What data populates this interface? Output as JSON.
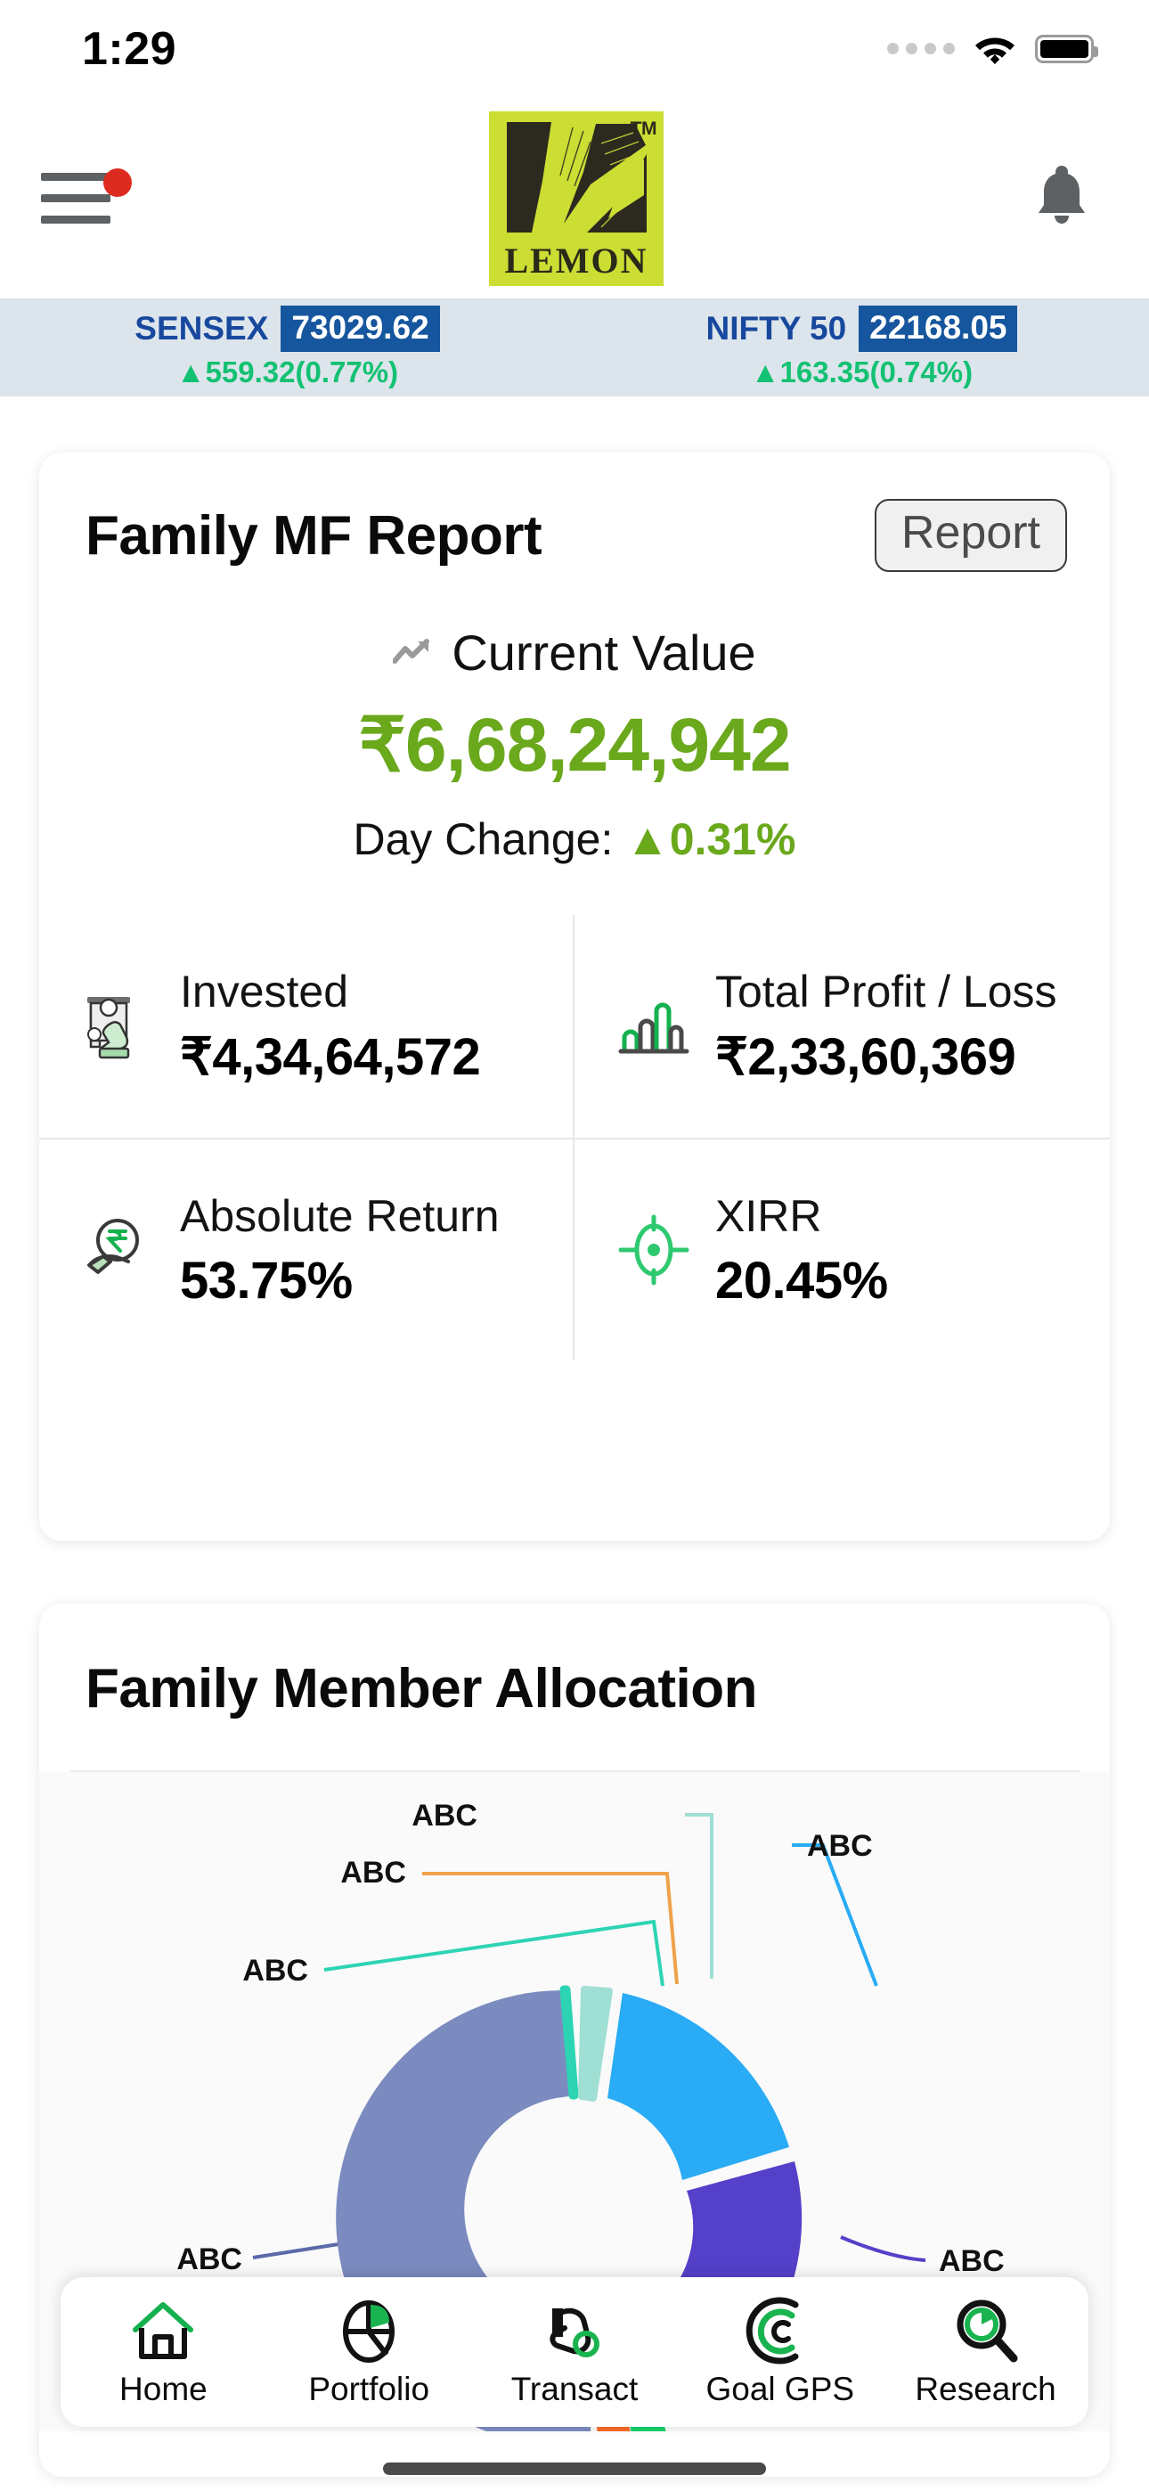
{
  "statusbar": {
    "time": "1:29",
    "signal_icon": "signal-dots-icon",
    "wifi_icon": "wifi-icon",
    "battery_icon": "battery-icon"
  },
  "header": {
    "menu_icon": "hamburger-menu-icon",
    "notification_dot": "notification-dot",
    "logo_word": "LEMON",
    "logo_tm": "TM",
    "bell_icon": "bell-icon"
  },
  "ticker": [
    {
      "name": "SENSEX",
      "value": "73029.62",
      "change": "▲559.32(0.77%)"
    },
    {
      "name": "NIFTY 50",
      "value": "22168.05",
      "change": "▲163.35(0.74%)"
    }
  ],
  "mf_report": {
    "title": "Family MF Report",
    "report_button": "Report",
    "current_value_label": "Current Value",
    "trend_icon": "trend-up-icon",
    "current_value": "₹6,68,24,942",
    "day_change_label": "Day Change:",
    "day_change_value": "▲0.31%",
    "stats": [
      {
        "icon": "hand-cash-icon",
        "label": "Invested",
        "value": "₹4,34,64,572"
      },
      {
        "icon": "bar-chart-icon",
        "label": "Total Profit / Loss",
        "value": "₹2,33,60,369"
      },
      {
        "icon": "hand-coin-icon",
        "label": "Absolute Return",
        "value": "53.75%"
      },
      {
        "icon": "target-icon",
        "label": "XIRR",
        "value": "20.45%"
      }
    ]
  },
  "allocation": {
    "title": "Family Member Allocation"
  },
  "chart_data": {
    "type": "pie",
    "title": "Family Member Allocation",
    "donut": true,
    "legend_position": "callout-labels",
    "labels": [
      "ABC",
      "ABC",
      "ABC",
      "ABC",
      "ABC",
      "ABC",
      "ABC"
    ],
    "slices": [
      {
        "label": "ABC",
        "value": 29.0,
        "color": "#29abf5",
        "callout": "top-right"
      },
      {
        "label": "ABC",
        "value": 26.0,
        "color": "#5440c9",
        "callout": "right"
      },
      {
        "label": "ABC",
        "value": 2.0,
        "color": "#16ce6a",
        "callout": "bottom"
      },
      {
        "label": "ABC",
        "value": 1.6,
        "color": "#f86a2b",
        "callout": "bottom"
      },
      {
        "label": "ABC",
        "value": 36.0,
        "color": "#7b8bbf",
        "callout": "left"
      },
      {
        "label": "ABC",
        "value": 1.4,
        "color": "#2dd4b4",
        "callout": "upper-left"
      },
      {
        "label": "ABC",
        "value": 4.0,
        "color": "#9fdfd4",
        "callout": "top"
      }
    ],
    "extra_callouts": [
      {
        "label": "ABC",
        "color": "#f0a24a"
      }
    ]
  },
  "bottom_nav": [
    {
      "icon": "home-icon",
      "label": "Home"
    },
    {
      "icon": "pie-chart-icon",
      "label": "Portfolio"
    },
    {
      "icon": "hand-coin-icon",
      "label": "Transact"
    },
    {
      "icon": "radar-icon",
      "label": "Goal GPS"
    },
    {
      "icon": "search-clock-icon",
      "label": "Research"
    }
  ],
  "colors": {
    "brand_green": "#6aa81c",
    "logo_bg": "#ccdd33",
    "ticker_bg": "#dce5ec",
    "ticker_blue": "#16569e",
    "up_green": "#13c172",
    "accent_green": "#14b14e",
    "notification_red": "#dd2b20"
  }
}
